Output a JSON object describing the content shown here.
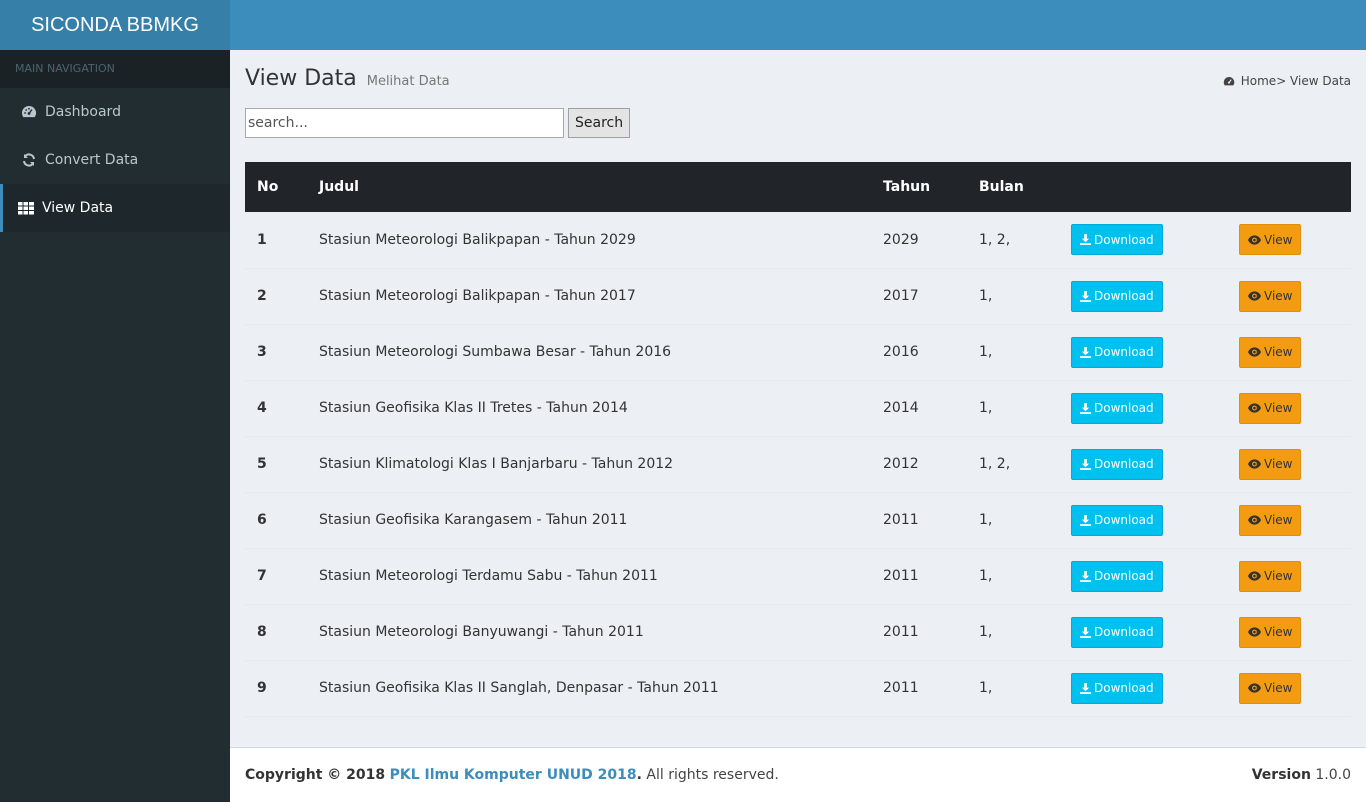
{
  "app": {
    "title": "SICONDA BBMKG"
  },
  "sidebar": {
    "header": "MAIN NAVIGATION",
    "items": [
      {
        "label": "Dashboard",
        "icon": "dashboard-icon"
      },
      {
        "label": "Convert Data",
        "icon": "refresh-icon"
      },
      {
        "label": "View Data",
        "icon": "grid-icon",
        "active": true
      }
    ]
  },
  "page": {
    "title": "View Data",
    "subtitle": "Melihat Data",
    "breadcrumb": "Home> View Data"
  },
  "search": {
    "placeholder": "search...",
    "button_label": "Search"
  },
  "table": {
    "headers": [
      "No",
      "Judul",
      "Tahun",
      "Bulan"
    ],
    "download_label": "Download",
    "view_label": "View",
    "rows": [
      {
        "no": "1",
        "judul": "Stasiun Meteorologi Balikpapan - Tahun 2029",
        "tahun": "2029",
        "bulan": "1, 2,"
      },
      {
        "no": "2",
        "judul": "Stasiun Meteorologi Balikpapan - Tahun 2017",
        "tahun": "2017",
        "bulan": "1,"
      },
      {
        "no": "3",
        "judul": "Stasiun Meteorologi Sumbawa Besar - Tahun 2016",
        "tahun": "2016",
        "bulan": "1,"
      },
      {
        "no": "4",
        "judul": "Stasiun Geofisika Klas II Tretes - Tahun 2014",
        "tahun": "2014",
        "bulan": "1,"
      },
      {
        "no": "5",
        "judul": "Stasiun Klimatologi Klas I Banjarbaru - Tahun 2012",
        "tahun": "2012",
        "bulan": "1, 2,"
      },
      {
        "no": "6",
        "judul": "Stasiun Geofisika Karangasem - Tahun 2011",
        "tahun": "2011",
        "bulan": "1,"
      },
      {
        "no": "7",
        "judul": "Stasiun Meteorologi Terdamu Sabu - Tahun 2011",
        "tahun": "2011",
        "bulan": "1,"
      },
      {
        "no": "8",
        "judul": "Stasiun Meteorologi Banyuwangi - Tahun 2011",
        "tahun": "2011",
        "bulan": "1,"
      },
      {
        "no": "9",
        "judul": "Stasiun Geofisika Klas II Sanglah, Denpasar - Tahun 2011",
        "tahun": "2011",
        "bulan": "1,"
      }
    ]
  },
  "footer": {
    "copyright_prefix": "Copyright © 2018",
    "link_text": "PKL Ilmu Komputer UNUD 2018",
    "suffix": ". All rights reserved.",
    "version_label": "Version",
    "version_value": "1.0.0"
  },
  "colors": {
    "topbar": "#3c8dbc",
    "sidebar": "#222d32",
    "download": "#00c0ef",
    "view": "#f39c12"
  }
}
